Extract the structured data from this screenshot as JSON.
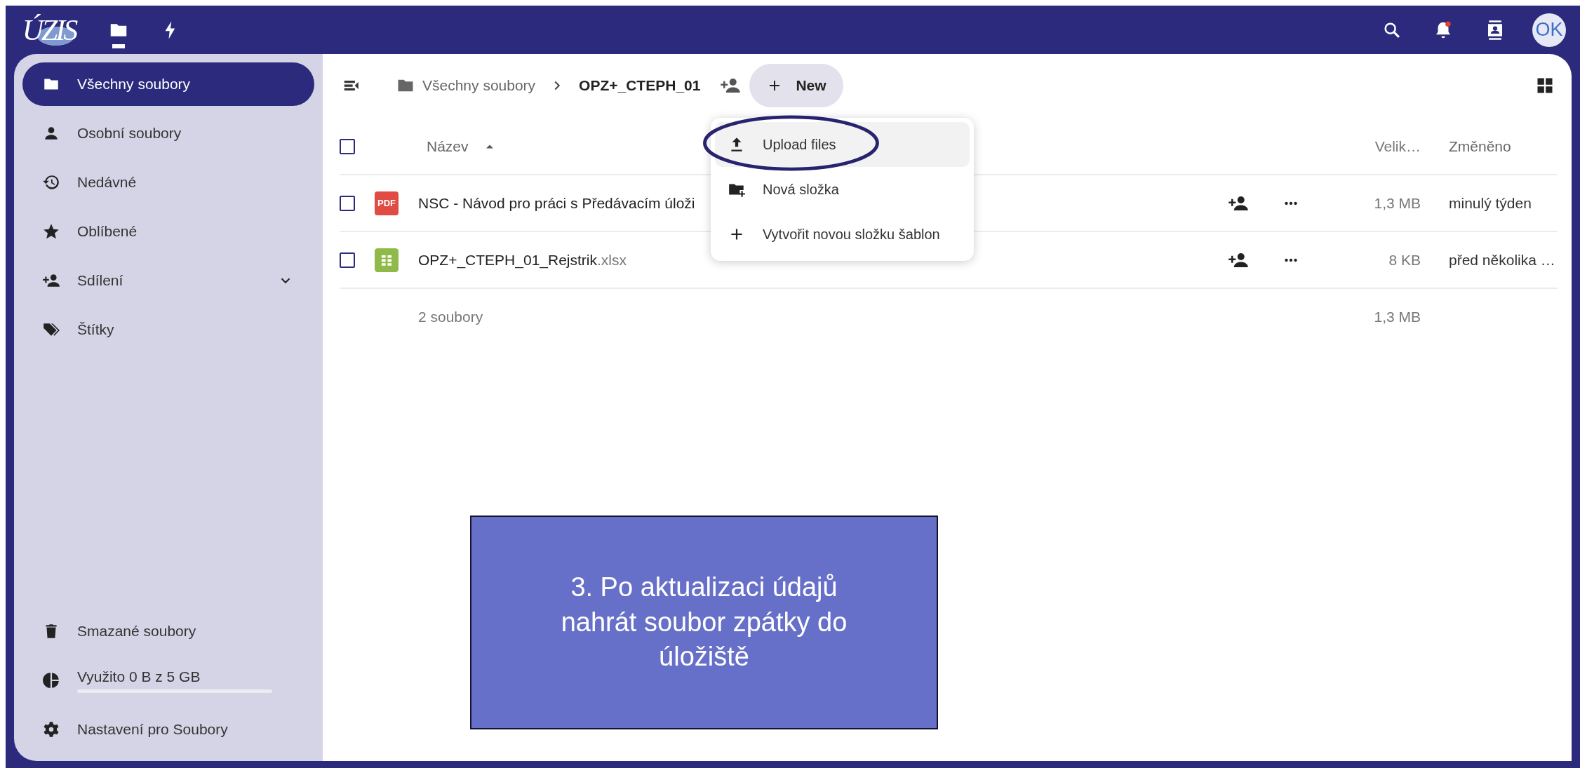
{
  "header": {
    "logo": "ÚZIS",
    "apps": [
      {
        "kind": "files",
        "selected": true
      },
      {
        "kind": "activity",
        "selected": false
      }
    ],
    "actions": [
      {
        "kind": "search"
      },
      {
        "kind": "notifications",
        "unread": true
      },
      {
        "kind": "contacts"
      }
    ],
    "avatar": "OK"
  },
  "sidebar": {
    "items": [
      {
        "label": "Všechny soubory",
        "selected": true,
        "expandable": false
      },
      {
        "label": "Osobní soubory",
        "selected": false,
        "expandable": false
      },
      {
        "label": "Nedávné",
        "selected": false,
        "expandable": false
      },
      {
        "label": "Oblíbené",
        "selected": false,
        "expandable": false
      },
      {
        "label": "Sdílení",
        "selected": false,
        "expandable": true
      },
      {
        "label": "Štítky",
        "selected": false,
        "expandable": false
      }
    ],
    "trash": "Smazané soubory",
    "storage": {
      "label": "Využito 0 B z 5 GB",
      "level": 0
    },
    "settings": "Nastavení pro Soubory"
  },
  "breadcrumbs": [
    "Všechny soubory",
    "OPZ+_CTEPH_01"
  ],
  "new_button": "New",
  "new_menu": [
    {
      "label": "Upload files",
      "selected": true
    },
    {
      "label": "Nová složka",
      "selected": false
    },
    {
      "label": "Vytvořit novou složku šablon",
      "selected": false
    }
  ],
  "table": {
    "columns": [
      "Název",
      "Velik…",
      "Změněno"
    ],
    "select_all": false,
    "rows": [
      {
        "kind": "pdf",
        "badge": "PDF",
        "name": "NSC - Návod pro práci s Předávacím úloži",
        "extension": "",
        "size": "1,3 MB",
        "modified": "minulý týden",
        "checked": false
      },
      {
        "kind": "spreadsheet",
        "name": "OPZ+_CTEPH_01_Rejstrik",
        "extension": ".xlsx",
        "size": "8 KB",
        "modified": "před několika …",
        "checked": false
      }
    ],
    "footer": {
      "count": "2 soubory",
      "size": "1,3 MB"
    }
  },
  "callout": [
    "3. Po aktualizaci údajů",
    "nahrát soubor zpátky do",
    "úložiště"
  ]
}
